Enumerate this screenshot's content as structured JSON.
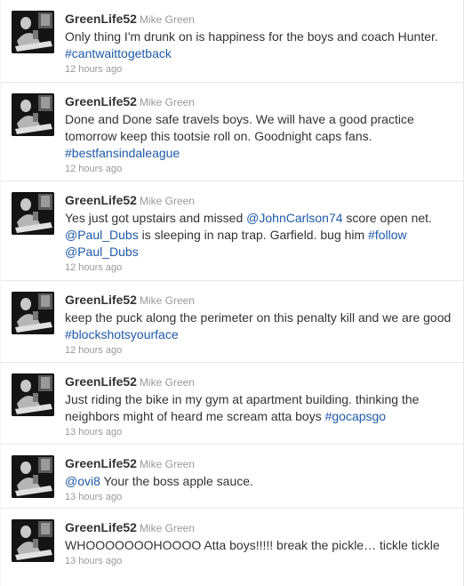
{
  "tweets": [
    {
      "screen_name": "GreenLife52",
      "full_name": "Mike Green",
      "avatar_icon": "profile-photo-icon",
      "text": [
        {
          "t": "Only thing I'm drunk on is happiness for the boys and coach Hunter. "
        },
        {
          "t": "#cantwaittogetback",
          "link": "hashtag"
        }
      ],
      "time": "12 hours ago"
    },
    {
      "screen_name": "GreenLife52",
      "full_name": "Mike Green",
      "avatar_icon": "profile-photo-icon",
      "text": [
        {
          "t": "Done and Done safe travels boys. We will have a good practice tomorrow keep this tootsie roll on. Goodnight caps fans. "
        },
        {
          "t": "#bestfansindaleague",
          "link": "hashtag"
        }
      ],
      "time": "12 hours ago"
    },
    {
      "screen_name": "GreenLife52",
      "full_name": "Mike Green",
      "avatar_icon": "profile-photo-icon",
      "text": [
        {
          "t": "Yes just got upstairs and missed "
        },
        {
          "t": "@JohnCarlson74",
          "link": "mention"
        },
        {
          "t": " score open net. "
        },
        {
          "t": "@Paul_Dubs",
          "link": "mention"
        },
        {
          "t": " is sleeping in nap trap. Garfield. bug him "
        },
        {
          "t": "#follow",
          "link": "hashtag"
        },
        {
          "t": " "
        },
        {
          "t": "@Paul_Dubs",
          "link": "mention"
        }
      ],
      "time": "12 hours ago"
    },
    {
      "screen_name": "GreenLife52",
      "full_name": "Mike Green",
      "avatar_icon": "profile-photo-icon",
      "text": [
        {
          "t": "keep the puck along the perimeter on this penalty kill and we are good "
        },
        {
          "t": "#blockshotsyourface",
          "link": "hashtag"
        }
      ],
      "time": "12 hours ago"
    },
    {
      "screen_name": "GreenLife52",
      "full_name": "Mike Green",
      "avatar_icon": "profile-photo-icon",
      "text": [
        {
          "t": "Just riding the bike in my gym at apartment building. thinking the neighbors might of heard me scream atta boys "
        },
        {
          "t": "#gocapsgo",
          "link": "hashtag"
        }
      ],
      "time": "13 hours ago"
    },
    {
      "screen_name": "GreenLife52",
      "full_name": "Mike Green",
      "avatar_icon": "profile-photo-icon",
      "text": [
        {
          "t": "@ovi8",
          "link": "mention"
        },
        {
          "t": " Your the boss apple sauce."
        }
      ],
      "time": "13 hours ago"
    },
    {
      "screen_name": "GreenLife52",
      "full_name": "Mike Green",
      "avatar_icon": "profile-photo-icon",
      "text": [
        {
          "t": "WHOOOOOOOHOOOO Atta boys!!!!! break the pickle… tickle tickle"
        }
      ],
      "time": "13 hours ago"
    }
  ],
  "colors": {
    "link": "#1e5aa8",
    "meta": "#999999",
    "text": "#333333",
    "divider": "#e8e8e8"
  }
}
